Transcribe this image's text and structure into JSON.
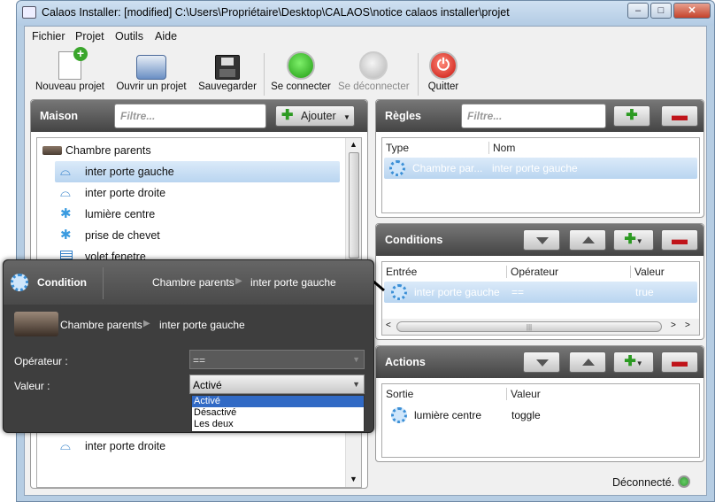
{
  "window": {
    "title": "Calaos Installer: [modified] C:\\Users\\Propriétaire\\Desktop\\CALAOS\\notice calaos installer\\projet",
    "minimize": "–",
    "maximize": "□",
    "close": "✕"
  },
  "menu": [
    "Fichier",
    "Projet",
    "Outils",
    "Aide"
  ],
  "toolbar": {
    "new": "Nouveau projet",
    "open": "Ouvrir un projet",
    "save": "Sauvegarder",
    "connect": "Se connecter",
    "disconnect": "Se déconnecter",
    "quit": "Quitter"
  },
  "maison": {
    "title": "Maison",
    "filter_placeholder": "Filtre...",
    "add": "Ajouter",
    "room": "Chambre parents",
    "items": [
      {
        "label": "inter porte gauche",
        "icon": "switch-icon",
        "selected": true
      },
      {
        "label": "inter porte droite",
        "icon": "switch-icon"
      },
      {
        "label": "lumière centre",
        "icon": "light-icon"
      },
      {
        "label": "prise de chevet",
        "icon": "light-icon"
      },
      {
        "label": "volet fenetre",
        "icon": "shutter-icon"
      }
    ],
    "bottom_item": "inter porte droite"
  },
  "regles": {
    "title": "Règles",
    "filter_placeholder": "Filtre...",
    "col_type": "Type",
    "col_name": "Nom",
    "row": {
      "type": "Chambre par...",
      "name": "inter porte gauche"
    }
  },
  "conditions": {
    "title": "Conditions",
    "col_entree": "Entrée",
    "col_operateur": "Opérateur",
    "col_valeur": "Valeur",
    "row": {
      "entree": "inter porte gauche",
      "operateur": "==",
      "valeur": "true"
    },
    "scroll_mark": "|||"
  },
  "actions": {
    "title": "Actions",
    "col_sortie": "Sortie",
    "col_valeur": "Valeur",
    "row": {
      "sortie": "lumière centre",
      "valeur": "toggle"
    }
  },
  "popup": {
    "title": "Condition",
    "room": "Chambre parents",
    "item": "inter porte gauche",
    "op_label": "Opérateur :",
    "op_value": "==",
    "val_label": "Valeur :",
    "val_value": "Activé",
    "options": [
      "Activé",
      "Désactivé",
      "Les deux"
    ]
  },
  "status": {
    "text": "Déconnecté."
  },
  "colors": {
    "accent": "#3b8fd6",
    "selection": "#c9def5",
    "header_dark": "#4a4a4a"
  }
}
